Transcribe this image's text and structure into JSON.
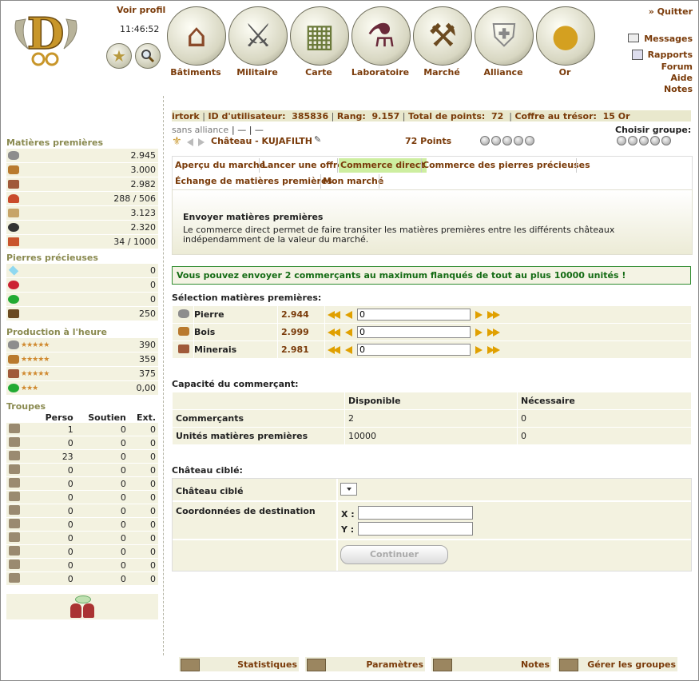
{
  "header": {
    "voir_profil": "Voir profil",
    "clock": "11:46:52",
    "nav": [
      {
        "label": "Bâtiments",
        "icon": "house-icon"
      },
      {
        "label": "Militaire",
        "icon": "crossed-swords-icon"
      },
      {
        "label": "Carte",
        "icon": "map-icon"
      },
      {
        "label": "Laboratoire",
        "icon": "flask-icon"
      },
      {
        "label": "Marché",
        "icon": "gavel-icon"
      },
      {
        "label": "Alliance",
        "icon": "shield-icon"
      },
      {
        "label": "Or",
        "icon": "gold-coin-icon"
      }
    ],
    "quitter": "» Quitter",
    "messages": "Messages",
    "rapports": "Rapports",
    "forum": "Forum",
    "aide": "Aide",
    "notes": "Notes"
  },
  "left": {
    "raw_title": "Matières premières",
    "raw": [
      {
        "icon": "stone-icon",
        "value": "2.945"
      },
      {
        "icon": "wood-icon",
        "value": "3.000"
      },
      {
        "icon": "ore-icon",
        "value": "2.982"
      },
      {
        "icon": "subjects-icon",
        "value": "288 / 506"
      },
      {
        "icon": "parchment-icon",
        "value": "3.123"
      },
      {
        "icon": "coal-icon",
        "value": "2.320"
      },
      {
        "icon": "bricks-icon",
        "value": "34 / 1000"
      }
    ],
    "gems_title": "Pierres précieuses",
    "gems": [
      {
        "icon": "diamond-icon",
        "value": "0"
      },
      {
        "icon": "ruby-icon",
        "value": "0"
      },
      {
        "icon": "emerald-icon",
        "value": "0"
      },
      {
        "icon": "chest-icon",
        "value": "250"
      }
    ],
    "prod_title": "Production à l'heure",
    "prod": [
      {
        "icon": "stone-icon",
        "stars": "★★★★★",
        "value": "390"
      },
      {
        "icon": "wood-icon",
        "stars": "★★★★★",
        "value": "359"
      },
      {
        "icon": "ore-icon",
        "stars": "★★★★★",
        "value": "375"
      },
      {
        "icon": "emerald-icon",
        "stars": "★★★",
        "value": "0,00"
      }
    ],
    "troops_title": "Troupes",
    "troops_headers": [
      "Perso",
      "Soutien",
      "Ext."
    ],
    "troops": [
      {
        "icon": "spear-icon",
        "perso": "1",
        "soutien": "0",
        "ext": "0"
      },
      {
        "icon": "sword-icon",
        "perso": "0",
        "soutien": "0",
        "ext": "0"
      },
      {
        "icon": "axe-icon",
        "perso": "23",
        "soutien": "0",
        "ext": "0"
      },
      {
        "icon": "bow-icon",
        "perso": "0",
        "soutien": "0",
        "ext": "0"
      },
      {
        "icon": "knight-icon",
        "perso": "0",
        "soutien": "0",
        "ext": "0"
      },
      {
        "icon": "horse-icon",
        "perso": "0",
        "soutien": "0",
        "ext": "0"
      },
      {
        "icon": "horse-archer-icon",
        "perso": "0",
        "soutien": "0",
        "ext": "0"
      },
      {
        "icon": "heavy-horse-icon",
        "perso": "0",
        "soutien": "0",
        "ext": "0"
      },
      {
        "icon": "lancer-icon",
        "perso": "0",
        "soutien": "0",
        "ext": "0"
      },
      {
        "icon": "catapult-icon",
        "perso": "0",
        "soutien": "0",
        "ext": "0"
      },
      {
        "icon": "ram-icon",
        "perso": "0",
        "soutien": "0",
        "ext": "0"
      },
      {
        "icon": "noble-icon",
        "perso": "0",
        "soutien": "0",
        "ext": "0"
      }
    ]
  },
  "infobar": {
    "user": "irtork",
    "id_label": "ID d'utilisateur:",
    "id_value": "385836",
    "rang_label": "Rang:",
    "rang_value": "9.157",
    "points_label": "Total de points:",
    "points_value": "72",
    "coffre_label": "Coffre au trésor:",
    "coffre_value": "15 Or"
  },
  "castle": {
    "alliance": "sans alliance",
    "alliance_links": "| — | —",
    "name": "Château - KUJAFILTH",
    "points": "72 Points",
    "groupe_label": "Choisir groupe:"
  },
  "tabs": [
    "Aperçu du marché",
    "Lancer une offre",
    "Commerce direct",
    "Commerce des pierres précieuses",
    "Échange de matières premières",
    "Mon marché"
  ],
  "desc": {
    "title": "Envoyer matières premières",
    "text": "Le commerce direct permet de faire transiter les matières premières entre les différents châteaux indépendamment de la valeur du marché."
  },
  "notice": "Vous pouvez envoyer 2 commerçants au maximum flanqués de tout au plus 10000 unités !",
  "selection": {
    "title": "Sélection matières premières:",
    "rows": [
      {
        "icon": "stone-icon",
        "name": "Pierre",
        "amount": "2.944",
        "input": "0"
      },
      {
        "icon": "wood-icon",
        "name": "Bois",
        "amount": "2.999",
        "input": "0"
      },
      {
        "icon": "ore-icon",
        "name": "Minerais",
        "amount": "2.981",
        "input": "0"
      }
    ]
  },
  "capacity": {
    "title": "Capacité du commerçant:",
    "headers": [
      "",
      "Disponible",
      "Nécessaire"
    ],
    "rows": [
      {
        "label": "Commerçants",
        "dispo": "2",
        "nec": "0"
      },
      {
        "label": "Unités matières premières",
        "dispo": "10000",
        "nec": "0"
      }
    ]
  },
  "target": {
    "title": "Château ciblé:",
    "castle_label": "Château ciblé",
    "coord_label": "Coordonnées de destination",
    "x_label": "X :",
    "y_label": "Y :",
    "x_value": "",
    "y_value": "",
    "continue": "Continuer"
  },
  "footer": {
    "stats": "Statistiques",
    "params": "Paramètres",
    "notes": "Notes",
    "groups": "Gérer les groupes"
  }
}
